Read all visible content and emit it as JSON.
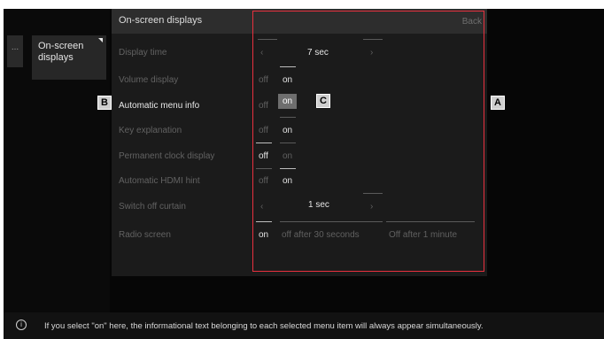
{
  "sidebar": {
    "small_item": "...",
    "active_item": "On-screen displays"
  },
  "menu": {
    "title": "On-screen displays",
    "back": "Back",
    "rows": [
      {
        "label": "Display time",
        "value": "7 sec"
      },
      {
        "label": "Volume display",
        "off": "off",
        "on": "on"
      },
      {
        "label": "Automatic menu info",
        "off": "off",
        "on": "on"
      },
      {
        "label": "Key explanation",
        "off": "off",
        "on": "on"
      },
      {
        "label": "Permanent clock display",
        "off": "off",
        "on": "on"
      },
      {
        "label": "Automatic HDMI hint",
        "off": "off",
        "on": "on"
      },
      {
        "label": "Switch off curtain",
        "value": "1 sec"
      },
      {
        "label": "Radio screen",
        "options": [
          "on",
          "off after 30 seconds",
          "Off after 1 minute"
        ]
      }
    ]
  },
  "callouts": {
    "a": "A",
    "b": "B",
    "c": "C"
  },
  "info_bar": {
    "text": "If you select \"on\" here, the informational text belonging to each selected menu item will always appear simultaneously."
  },
  "colors": {
    "callout_box": "#e8303e",
    "highlight": "#6e6e6e",
    "menu_background": "#1b1b1b"
  }
}
